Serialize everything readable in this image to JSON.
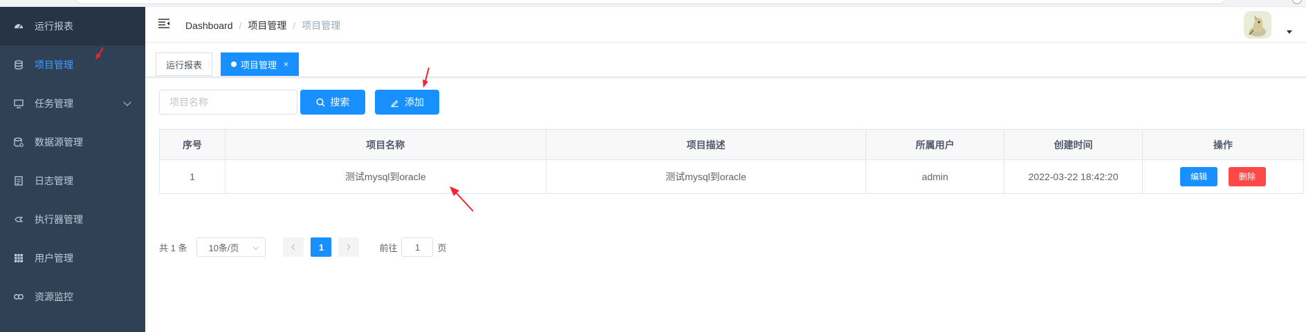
{
  "sidebar": {
    "items": [
      {
        "label": "运行报表",
        "icon": "dashboard-icon"
      },
      {
        "label": "项目管理",
        "icon": "database-icon",
        "active": true
      },
      {
        "label": "任务管理",
        "icon": "monitor-icon",
        "has_submenu": true
      },
      {
        "label": "数据源管理",
        "icon": "datasource-icon"
      },
      {
        "label": "日志管理",
        "icon": "log-icon"
      },
      {
        "label": "执行器管理",
        "icon": "executor-icon"
      },
      {
        "label": "用户管理",
        "icon": "table-icon"
      },
      {
        "label": "资源监控",
        "icon": "link-icon"
      }
    ]
  },
  "navbar": {
    "breadcrumb": [
      "Dashboard",
      "项目管理",
      "项目管理"
    ],
    "separator": "/"
  },
  "tags": [
    {
      "label": "运行报表",
      "active": false
    },
    {
      "label": "项目管理",
      "active": true,
      "close": "×"
    }
  ],
  "toolbar": {
    "search_placeholder": "项目名称",
    "search_label": "搜索",
    "add_label": "添加"
  },
  "table": {
    "headers": [
      "序号",
      "项目名称",
      "项目描述",
      "所属用户",
      "创建时间",
      "操作"
    ],
    "rows": [
      {
        "index": "1",
        "name": "测试mysql到oracle",
        "description": "测试mysql到oracle",
        "user": "admin",
        "created": "2022-03-22 18:42:20"
      }
    ],
    "edit_label": "编辑",
    "delete_label": "删除"
  },
  "pagination": {
    "total": "共 1 条",
    "page_size": "10条/页",
    "current_page": "1",
    "goto_prefix": "前往",
    "goto_value": "1",
    "goto_suffix": "页"
  },
  "colors": {
    "sidebar_bg": "#304156",
    "primary": "#1890ff",
    "danger": "#ff4949",
    "annotation": "#f5222d"
  }
}
